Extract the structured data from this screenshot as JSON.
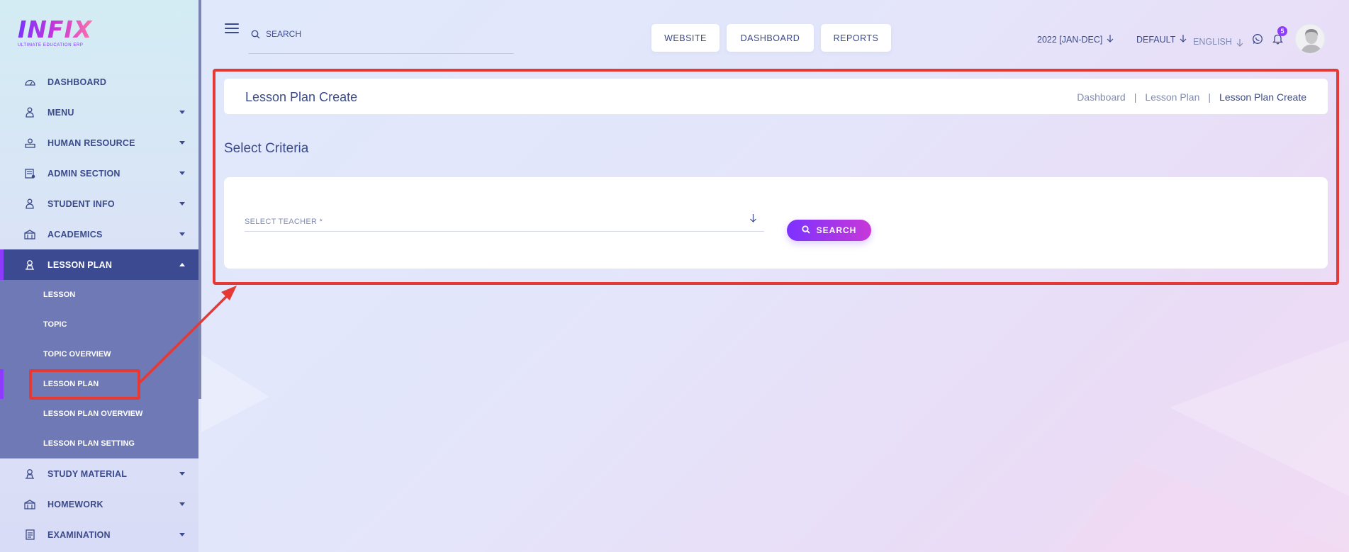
{
  "colors": {
    "accent": "#7c32ff",
    "accent_end": "#c738d8",
    "nav_active": "#3c4b91",
    "submenu_bg": "#6e79b5",
    "text_primary": "#3b4a8a",
    "annotation": "#e53935"
  },
  "logo": {
    "text": "INFIX",
    "subtitle": "ULTIMATE EDUCATION ERP"
  },
  "sidebar": {
    "items": [
      {
        "label": "DASHBOARD",
        "icon": "dashboard-icon",
        "has_caret": false
      },
      {
        "label": "MENU",
        "icon": "menu-user-icon",
        "has_caret": true
      },
      {
        "label": "HUMAN RESOURCE",
        "icon": "human-resource-icon",
        "has_caret": true
      },
      {
        "label": "ADMIN SECTION",
        "icon": "admin-section-icon",
        "has_caret": true
      },
      {
        "label": "STUDENT INFO",
        "icon": "student-info-icon",
        "has_caret": true
      },
      {
        "label": "ACADEMICS",
        "icon": "academics-icon",
        "has_caret": true
      },
      {
        "label": "LESSON PLAN",
        "icon": "lesson-plan-icon",
        "has_caret": true,
        "expanded": true
      },
      {
        "label": "STUDY MATERIAL",
        "icon": "study-material-icon",
        "has_caret": true
      },
      {
        "label": "HOMEWORK",
        "icon": "homework-icon",
        "has_caret": true
      },
      {
        "label": "EXAMINATION",
        "icon": "examination-icon",
        "has_caret": true
      }
    ],
    "lesson_plan_submenu": [
      {
        "label": "LESSON"
      },
      {
        "label": "TOPIC"
      },
      {
        "label": "TOPIC OVERVIEW"
      },
      {
        "label": "LESSON PLAN",
        "active": true
      },
      {
        "label": "LESSON PLAN OVERVIEW"
      },
      {
        "label": "LESSON PLAN SETTING"
      }
    ]
  },
  "topbar": {
    "search_placeholder": "SEARCH",
    "buttons": {
      "website": "WEBSITE",
      "dashboard": "DASHBOARD",
      "reports": "REPORTS"
    },
    "session": "2022 [JAN-DEC]",
    "style": "DEFAULT",
    "language": "ENGLISH",
    "notification_count": "5"
  },
  "page": {
    "title": "Lesson Plan Create",
    "breadcrumb": [
      "Dashboard",
      "Lesson Plan",
      "Lesson Plan Create"
    ],
    "section_title": "Select Criteria",
    "teacher_select_placeholder": "SELECT TEACHER *",
    "search_button": "SEARCH"
  }
}
